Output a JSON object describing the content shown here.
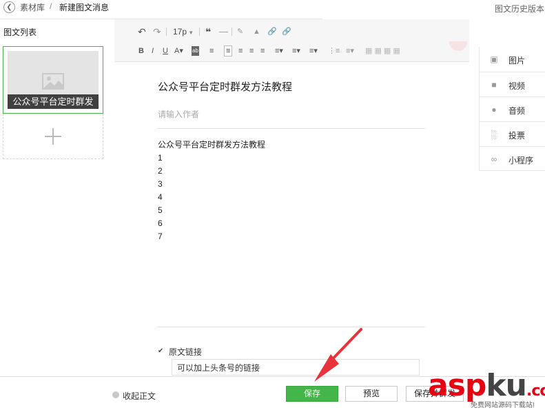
{
  "breadcrumb": {
    "back_icon": "chevron-left-icon",
    "root": "素材库",
    "separator": "/",
    "current": "新建图文消息"
  },
  "history_link": "图文历史版本",
  "sidebar": {
    "title": "图文列表",
    "articles": [
      {
        "title": "公众号平台定时群发",
        "cover_icon": "image-placeholder-icon"
      }
    ],
    "add_icon": "plus-icon"
  },
  "toolbar": {
    "row1": [
      "undo-icon",
      "redo-icon",
      "font-size-dropdown",
      "blockquote-icon",
      "horizontal-rule-icon",
      "format-painter-icon",
      "clear-format-icon",
      "link-icon",
      "unlink-icon"
    ],
    "font_size": "17p",
    "row2": [
      "bold-icon",
      "italic-icon",
      "underline-icon",
      "font-color-icon",
      "background-color-icon",
      "indent-icon",
      "align-left-icon",
      "align-center-icon",
      "align-right-icon",
      "justify-icon",
      "line-height-icon",
      "paragraph-spacing-icon",
      "letter-spacing-icon",
      "ordered-list-icon",
      "unordered-list-icon",
      "table-icon"
    ]
  },
  "article": {
    "title": "公众号平台定时群发方法教程",
    "author_placeholder": "请输入作者",
    "body_lines": [
      "公众号平台定时群发方法教程",
      "1",
      "2",
      "3",
      "4",
      "5",
      "6",
      "7"
    ],
    "original_link_label": "原文链接",
    "original_link_checked": true,
    "original_link_value": "可以加上头条号的链接"
  },
  "insert_panel": [
    {
      "icon": "image-icon",
      "label": "图片"
    },
    {
      "icon": "video-icon",
      "label": "视频"
    },
    {
      "icon": "microphone-icon",
      "label": "音频"
    },
    {
      "icon": "poll-icon",
      "label": "投票"
    },
    {
      "icon": "mini-program-icon",
      "label": "小程序"
    }
  ],
  "footer": {
    "collapse_label": "收起正文",
    "save_label": "保存",
    "preview_label": "预览",
    "save_send_label": "保存并群发"
  },
  "watermark": {
    "logo": "aspku",
    "tagline": "免费网站源码下载站!"
  },
  "colors": {
    "accent_green": "#44b549",
    "watermark_red": "#e60012",
    "arrow_red": "#e8323c"
  }
}
